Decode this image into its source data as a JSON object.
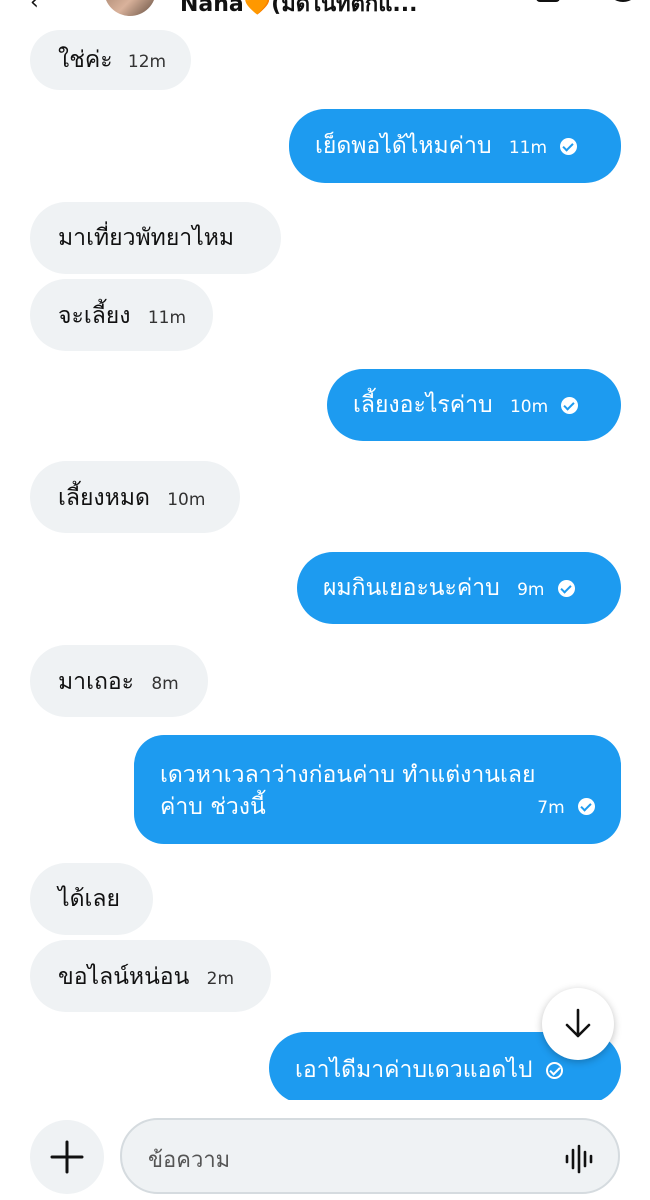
{
  "header": {
    "chat_name": "Nana🧡(มิดไนท์ตั๊กแ..."
  },
  "messages": [
    {
      "direction": "in",
      "text": "ใช่ค่ะ",
      "time": "12m"
    },
    {
      "direction": "out",
      "text": "เย็ดพอได้ไหมค่าบ",
      "time": "11m",
      "status": "sent"
    },
    {
      "direction": "in",
      "text": "มาเที่ยวพัทยาไหม",
      "time": ""
    },
    {
      "direction": "in",
      "text": "จะเลี้ยง",
      "time": "11m"
    },
    {
      "direction": "out",
      "text": "เลี้ยงอะไรค่าบ",
      "time": "10m",
      "status": "sent"
    },
    {
      "direction": "in",
      "text": "เลี้ยงหมด",
      "time": "10m"
    },
    {
      "direction": "out",
      "text": "ผมกินเยอะนะค่าบ",
      "time": "9m",
      "status": "sent"
    },
    {
      "direction": "in",
      "text": "มาเถอะ",
      "time": "8m"
    },
    {
      "direction": "out",
      "text_line1": "เดวหาเวลาว่างก่อนค่าบ ทำแต่งานเลย",
      "text_line2": "ค่าบ ช่วงนี้",
      "time": "7m",
      "status": "sent"
    },
    {
      "direction": "in",
      "text": "ได้เลย",
      "time": ""
    },
    {
      "direction": "in",
      "text": "ขอไลน์หน่อน",
      "time": "2m"
    },
    {
      "direction": "out",
      "text": "เอาไดีมาค่าบเดวแอดไป",
      "time": "",
      "status": "sending"
    }
  ],
  "composer": {
    "placeholder": "ข้อความ"
  },
  "icons": {
    "scroll_down": "arrow-down-icon",
    "add": "plus-icon",
    "voice": "voice-wave-icon"
  },
  "colors": {
    "outgoing_bubble": "#1d9bf0",
    "incoming_bubble": "#eff2f4"
  }
}
